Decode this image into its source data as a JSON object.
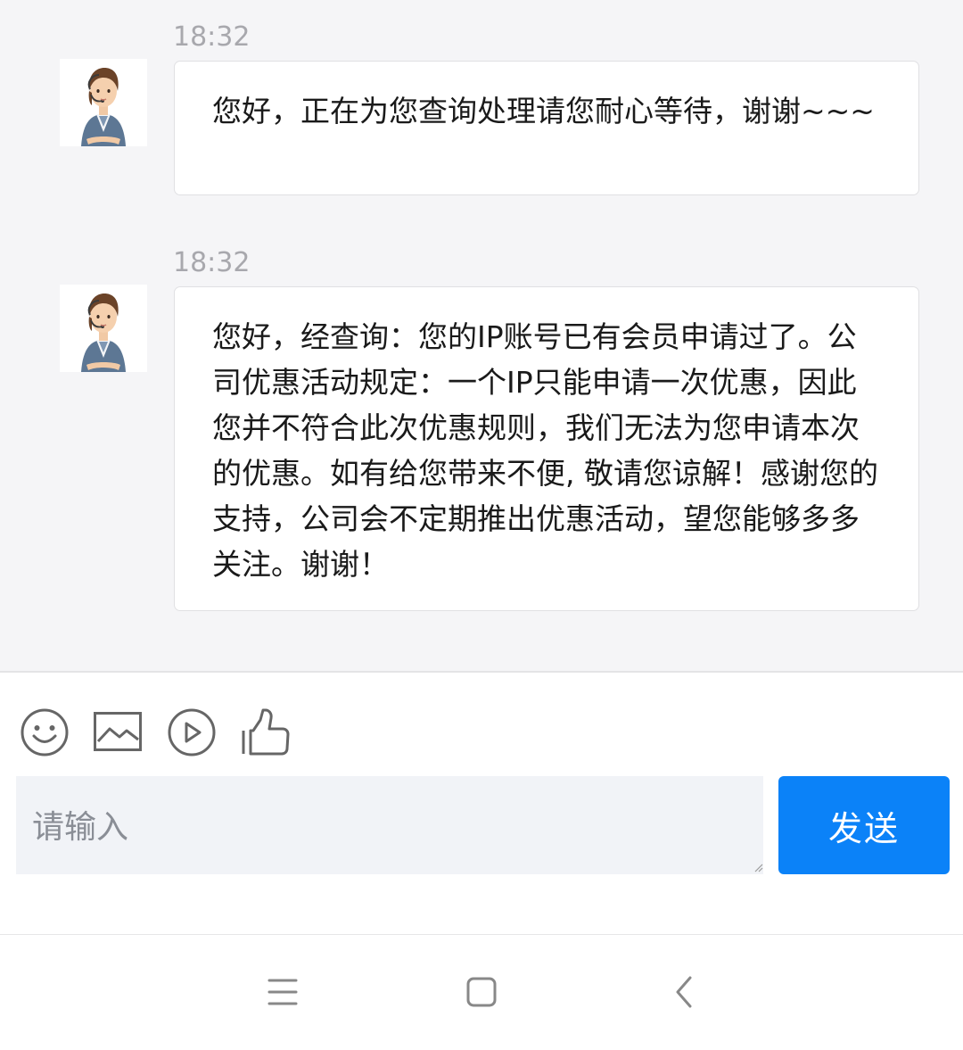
{
  "messages": [
    {
      "time": "18:32",
      "sender": "agent",
      "text": "您好，正在为您查询处理请您耐心等待，谢谢~~~"
    },
    {
      "time": "18:32",
      "sender": "agent",
      "text": "您好，经查询：您的IP账号已有会员申请过了。公司优惠活动规定：一个IP只能申请一次优惠，因此您并不符合此次优惠规则，我们无法为您申请本次的优惠。如有给您带来不便, 敬请您谅解！感谢您的支持，公司会不定期推出优惠活动，望您能够多多关注。谢谢！"
    }
  ],
  "composer": {
    "placeholder": "请输入",
    "value": "",
    "send_label": "发送",
    "tools": [
      "emoji-icon",
      "image-icon",
      "video-icon",
      "thumbs-up-icon"
    ]
  },
  "navbar": {
    "icons": [
      "menu-icon",
      "home-icon",
      "back-icon"
    ]
  },
  "colors": {
    "accent": "#0b82f8",
    "chat_background": "#f5f5f7",
    "input_background": "#f1f3f7"
  }
}
